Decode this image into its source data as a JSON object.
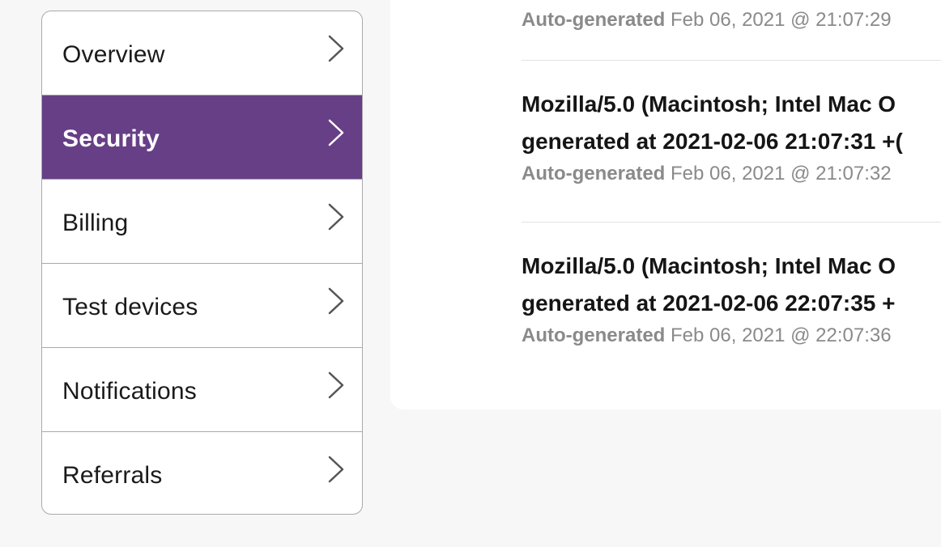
{
  "sidebar": {
    "items": [
      {
        "label": "Overview",
        "active": false
      },
      {
        "label": "Security",
        "active": true
      },
      {
        "label": "Billing",
        "active": false
      },
      {
        "label": "Test devices",
        "active": false
      },
      {
        "label": "Notifications",
        "active": false
      },
      {
        "label": "Referrals",
        "active": false
      }
    ],
    "active_color": "#673f86",
    "chevron_icon": "chevron-right-icon"
  },
  "sessions": {
    "items": [
      {
        "title_line1": "",
        "title_line2": "",
        "source": "Auto-generated",
        "timestamp": "Feb 06, 2021 @ 21:07:29"
      },
      {
        "title_line1": "Mozilla/5.0 (Macintosh; Intel Mac O",
        "title_line2": "generated at 2021-02-06 21:07:31 +(",
        "source": "Auto-generated",
        "timestamp": "Feb 06, 2021 @ 21:07:32"
      },
      {
        "title_line1": "Mozilla/5.0 (Macintosh; Intel Mac O",
        "title_line2": "generated at 2021-02-06 22:07:35 +",
        "source": "Auto-generated",
        "timestamp": "Feb 06, 2021 @ 22:07:36"
      }
    ]
  }
}
